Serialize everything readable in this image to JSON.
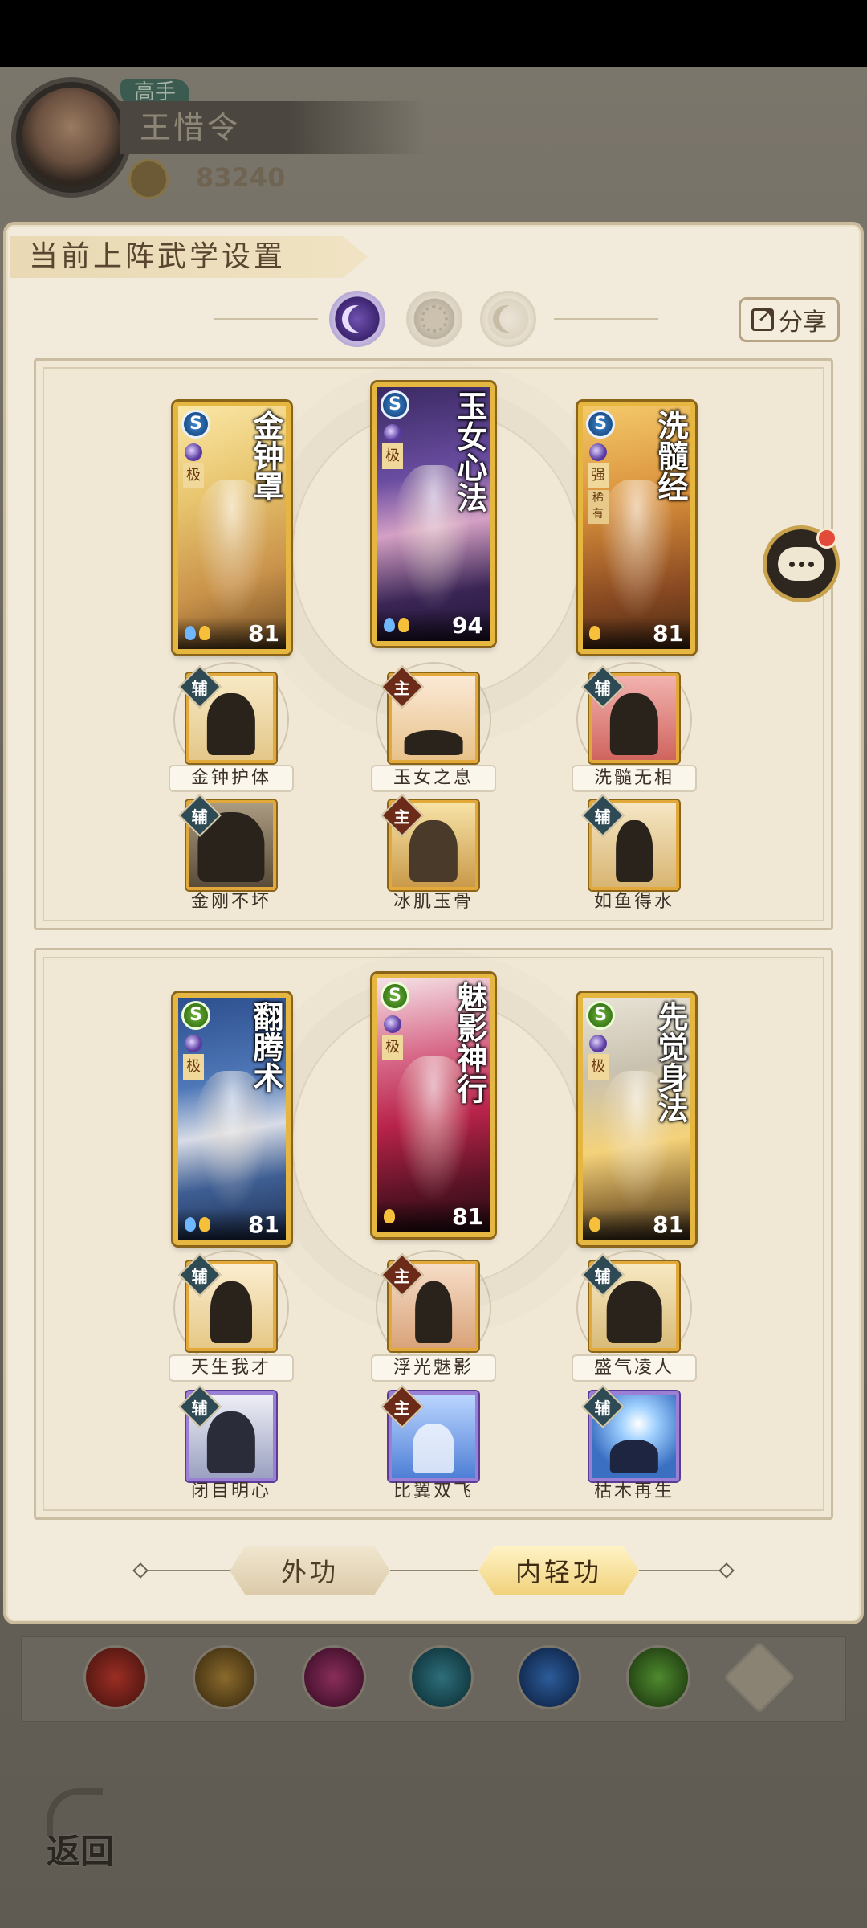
{
  "profile": {
    "rank": "高手",
    "name": "王惜令",
    "power": "83240"
  },
  "panel": {
    "title": "当前上阵武学设置",
    "share_label": "分享",
    "phase_icons": [
      "moon-icon",
      "sun-icon",
      "crescent-icon"
    ],
    "active_phase": "moon-icon"
  },
  "groups": [
    {
      "cards": [
        {
          "title": "金钟罩",
          "grade": "S",
          "tier": "极",
          "level": "81",
          "art": "gold"
        },
        {
          "title": "玉女心法",
          "grade": "S",
          "tier": "极",
          "level": "94",
          "art": "purple"
        },
        {
          "title": "洗髓经",
          "grade": "S",
          "tier": "强",
          "tier2": "稀有",
          "level": "81",
          "art": "amber"
        }
      ],
      "slots_top": [
        {
          "label": "金钟护体",
          "role": "辅"
        },
        {
          "label": "玉女之息",
          "role": "主"
        },
        {
          "label": "洗髓无相",
          "role": "辅"
        }
      ],
      "slots_bottom": [
        {
          "label": "金刚不坏",
          "role": "辅"
        },
        {
          "label": "冰肌玉骨",
          "role": "主"
        },
        {
          "label": "如鱼得水",
          "role": "辅"
        }
      ]
    },
    {
      "cards": [
        {
          "title": "翻腾术",
          "grade": "S",
          "tier": "极",
          "level": "81",
          "art": "blue"
        },
        {
          "title": "魅影神行",
          "grade": "S",
          "tier": "极",
          "level": "81",
          "art": "crimson"
        },
        {
          "title": "先觉身法",
          "grade": "S",
          "tier": "极",
          "level": "81",
          "art": "dawn"
        }
      ],
      "slots_top": [
        {
          "label": "天生我才",
          "role": "辅"
        },
        {
          "label": "浮光魅影",
          "role": "主"
        },
        {
          "label": "盛气凌人",
          "role": "辅"
        }
      ],
      "slots_bottom": [
        {
          "label": "闭目明心",
          "role": "辅"
        },
        {
          "label": "比翼双飞",
          "role": "主"
        },
        {
          "label": "枯木再生",
          "role": "辅"
        }
      ]
    }
  ],
  "tabs": {
    "outer": "外功",
    "inner": "内轻功",
    "active": "inner"
  },
  "bottom": {
    "back_label": "返回"
  },
  "colors": {
    "panel_bg": "#f2eadb",
    "gold_frame": "#e6b740",
    "aux_badge": "#2e4a55",
    "main_badge": "#6c2a18"
  }
}
